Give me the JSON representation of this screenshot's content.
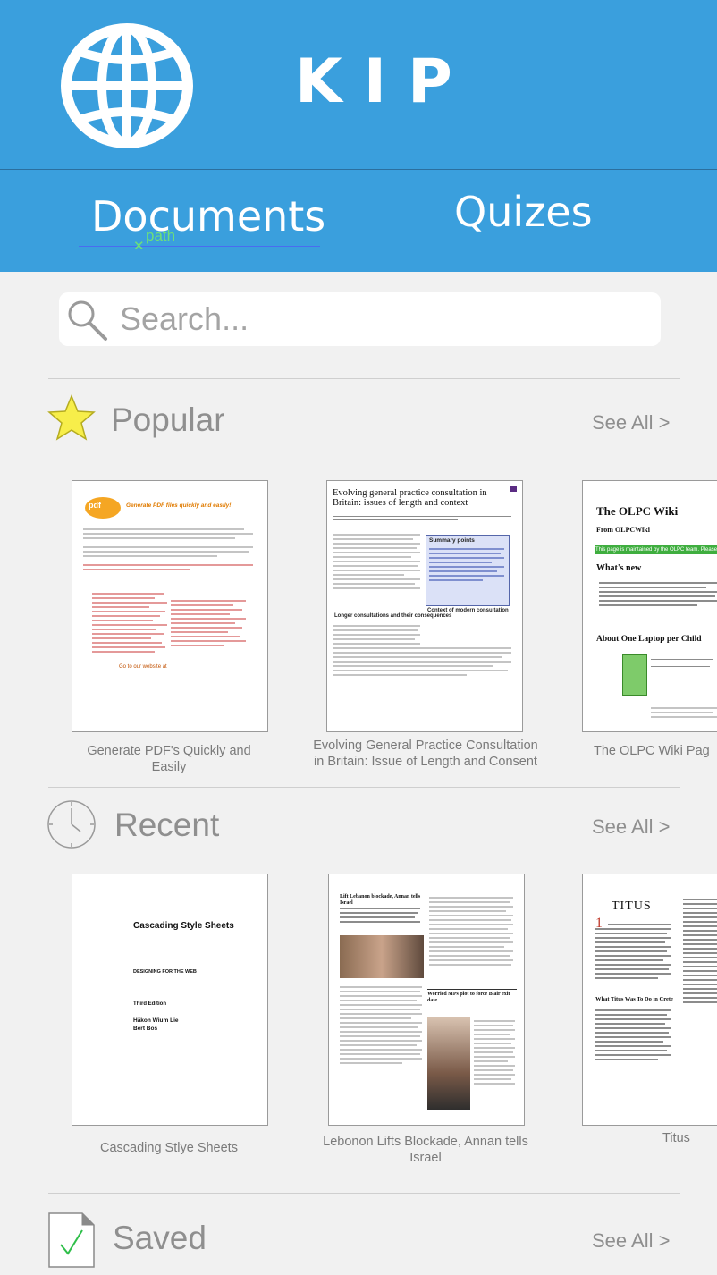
{
  "app": {
    "title": "KIP",
    "logo_icon": "globe-icon"
  },
  "tabs": [
    {
      "label": "Documents",
      "active": true
    },
    {
      "label": "Quizes",
      "active": false
    }
  ],
  "tab_overlay": {
    "label": "path"
  },
  "search": {
    "placeholder": "Search...",
    "icon": "search-icon"
  },
  "sections": {
    "popular": {
      "title": "Popular",
      "icon": "star-icon",
      "see_all": "See All >",
      "items": [
        {
          "caption": "Generate PDF's Quickly and Easily",
          "thumb": {
            "logo": "pdf",
            "heading": "Generate PDF files quickly and easily!",
            "footer": "Go to our website at"
          }
        },
        {
          "caption": "Evolving General Practice Consultation in Britain: Issue of Length and Consent",
          "thumb": {
            "heading": "Evolving general practice consultation in Britain: issues of length and context",
            "box_heading": "Summary points",
            "subheading": "Longer consultations and their consequences",
            "subheading2": "Context of modern consultation"
          }
        },
        {
          "caption": "The OLPC Wiki Pag",
          "thumb": {
            "heading": "The OLPC Wiki",
            "from": "From OLPCWiki",
            "green_bar": "This page is maintained by the OLPC team. Please use the talk page.",
            "whats_new": "What's new",
            "about": "About One Laptop per Child"
          }
        }
      ]
    },
    "recent": {
      "title": "Recent",
      "icon": "clock-icon",
      "see_all": "See All >",
      "items": [
        {
          "caption": "Cascading Stlye Sheets",
          "thumb": {
            "heading": "Cascading Style Sheets",
            "sub": "DESIGNING FOR THE WEB",
            "edition": "Third Edition",
            "author1": "Håkon Wium Lie",
            "author2": "Bert Bos"
          }
        },
        {
          "caption": "Lebonon Lifts Blockade, Annan tells Israel",
          "thumb": {
            "heading": "Lift Lebanon blockade, Annan tells Israel",
            "heading2": "Worried MPs plot to force Blair exit date"
          }
        },
        {
          "caption": "Titus",
          "thumb": {
            "heading": "TITUS",
            "verse_num": "1",
            "sub": "What Titus Was To Do in Crete"
          }
        }
      ]
    },
    "saved": {
      "title": "Saved",
      "icon": "checked-document-icon",
      "see_all": "See All >"
    }
  },
  "colors": {
    "header_blue": "#3a9fdd",
    "page_bg": "#f1f1f1",
    "star_yellow": "#f7ee4a",
    "check_green": "#2fbf4a"
  }
}
